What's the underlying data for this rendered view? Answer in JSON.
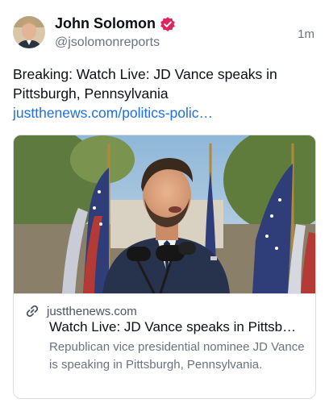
{
  "post": {
    "author": {
      "display_name": "John Solomon",
      "handle": "@jsolomonreports",
      "verified_icon": "verified-badge-icon"
    },
    "timestamp": "1m",
    "text": {
      "body": "Breaking: Watch Live: JD Vance speaks in Pittsburgh, Pennsylvania ",
      "link": "justthenews.com/politics-polic…"
    },
    "link_card": {
      "image_alt": "JD Vance speaking at a podium with microphones and American flags behind him",
      "domain": "justthenews.com",
      "title": "Watch Live: JD Vance speaks in Pittsb…",
      "description": "Republican vice presidential nominee JD Vance is speaking in Pittsburgh, Pennsylvania."
    }
  },
  "colors": {
    "accent_link": "#1d6fe6",
    "verified_badge": "#e0245e",
    "muted_text": "#6b7280"
  }
}
